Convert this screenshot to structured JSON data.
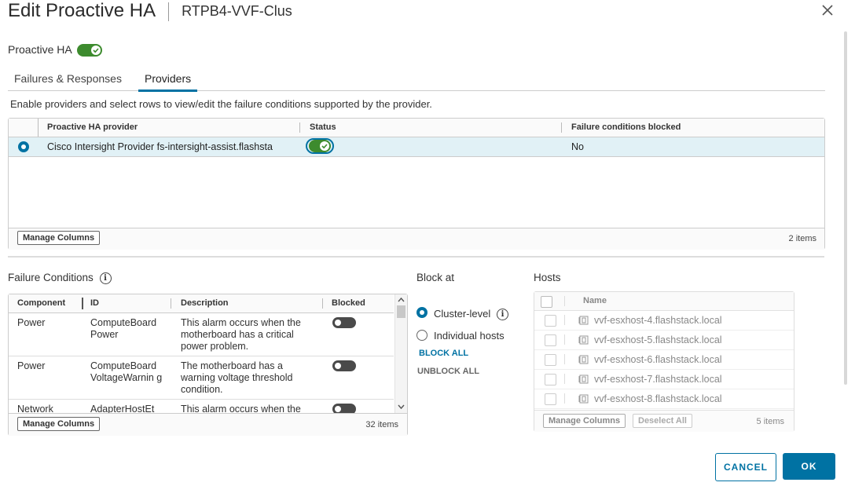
{
  "dialog": {
    "title": "Edit Proactive HA",
    "subtitle": "RTPB4-VVF-Clus"
  },
  "proactive_ha": {
    "label": "Proactive HA",
    "enabled": true
  },
  "tabs": [
    {
      "label": "Failures & Responses",
      "active": false
    },
    {
      "label": "Providers",
      "active": true
    }
  ],
  "providers": {
    "instruction": "Enable providers and select rows to view/edit the failure conditions supported by the provider.",
    "columns": [
      "Proactive HA provider",
      "Status",
      "Failure conditions blocked"
    ],
    "rows": [
      {
        "provider": "Cisco Intersight Provider fs-intersight-assist.flashsta",
        "status_enabled": true,
        "blocked": "No",
        "selected": true
      }
    ],
    "manage_columns": "Manage Columns",
    "count": "2 items"
  },
  "failure_conditions": {
    "label": "Failure Conditions",
    "columns": [
      "Component",
      "ID",
      "Description",
      "Blocked"
    ],
    "rows": [
      {
        "component": "Power",
        "id": "ComputeBoard Power",
        "description": "This alarm occurs when the motherboard has a critical power problem."
      },
      {
        "component": "Power",
        "id": "ComputeBoard VoltageWarnin g",
        "description": "The motherboard has a warning voltage threshold condition."
      },
      {
        "component": "Network",
        "id": "AdapterHostEt",
        "description": "This alarm occurs when the"
      }
    ],
    "manage_columns": "Manage Columns",
    "count": "32 items"
  },
  "block_at": {
    "label": "Block at",
    "options": [
      {
        "label": "Cluster-level",
        "selected": true
      },
      {
        "label": "Individual hosts",
        "selected": false
      }
    ],
    "block_all": "BLOCK ALL",
    "unblock_all": "UNBLOCK ALL"
  },
  "hosts": {
    "label": "Hosts",
    "column": "Name",
    "rows": [
      "vvf-esxhost-4.flashstack.local",
      "vvf-esxhost-5.flashstack.local",
      "vvf-esxhost-6.flashstack.local",
      "vvf-esxhost-7.flashstack.local",
      "vvf-esxhost-8.flashstack.local"
    ],
    "manage_columns": "Manage Columns",
    "deselect_all": "Deselect All",
    "count": "5 items"
  },
  "footer": {
    "cancel": "CANCEL",
    "ok": "OK"
  },
  "colors": {
    "accent": "#0072a3",
    "toggle_on": "#3d8b2e",
    "selected_row": "#e1f1f6"
  },
  "icons": {
    "close": "close-icon",
    "info": "info-icon",
    "check": "check-icon",
    "host": "host-icon"
  }
}
